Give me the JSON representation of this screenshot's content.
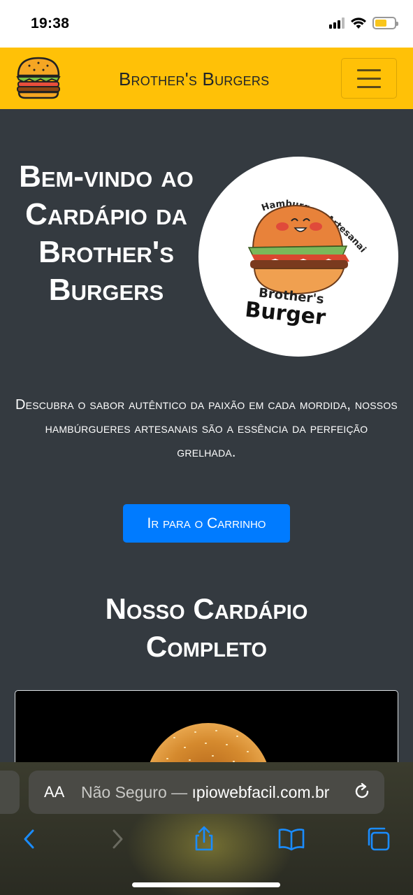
{
  "status_bar": {
    "time": "19:38",
    "battery_level": 0.6
  },
  "navbar": {
    "brand": "Brother's Burgers",
    "logo_icon": "burger-icon",
    "menu_icon": "hamburger-menu-icon"
  },
  "hero": {
    "title": "Bem-vindo ao Cardápio da Brother's Burgers",
    "logo": {
      "top_text": "Hamburgers Artesanais!",
      "brand_line1": "Brother's",
      "brand_line2": "Burger"
    },
    "description": "Descubra o sabor autêntico da paixão em cada mordida, nossos hambúrgueres artesanais são a essência da perfeição grelhada.",
    "cart_button": "Ir para o Carrinho"
  },
  "menu": {
    "title": "Nosso Cardápio Completo"
  },
  "browser": {
    "aa_label": "AA",
    "url_prefix": "Não Seguro — ",
    "url_domain": "ıpiowebfacil.com.br",
    "icons": [
      "back-icon",
      "forward-icon",
      "share-icon",
      "bookmarks-icon",
      "tabs-icon",
      "reload-icon"
    ]
  },
  "colors": {
    "navbar": "#ffc107",
    "page_bg": "#343a40",
    "button": "#007bff"
  }
}
